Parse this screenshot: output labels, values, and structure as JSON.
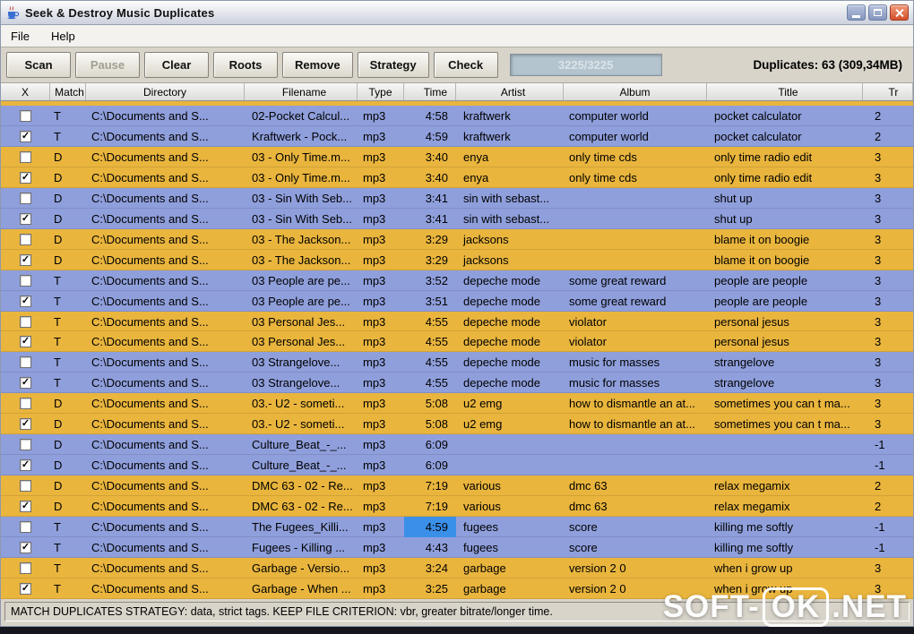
{
  "window": {
    "title": "Seek & Destroy Music Duplicates"
  },
  "menu": {
    "items": [
      "File",
      "Help"
    ]
  },
  "toolbar": {
    "buttons": [
      {
        "label": "Scan",
        "enabled": true
      },
      {
        "label": "Pause",
        "enabled": false
      },
      {
        "label": "Clear",
        "enabled": true
      },
      {
        "label": "Roots",
        "enabled": true
      },
      {
        "label": "Remove",
        "enabled": true
      },
      {
        "label": "Strategy",
        "enabled": true
      },
      {
        "label": "Check",
        "enabled": true
      }
    ],
    "progress_text": "3225/3225",
    "duplicates_label": "Duplicates: 63 (309,34MB)"
  },
  "table": {
    "columns": [
      "X",
      "Match",
      "Directory",
      "Filename",
      "Type",
      "Time",
      "Artist",
      "Album",
      "Title",
      "Tr"
    ],
    "check_glyph": "✓",
    "rows": [
      {
        "group": "blue",
        "checked": false,
        "match": "T",
        "dir": "C:\\Documents and S...",
        "file": "02-Pocket Calcul...",
        "type": "mp3",
        "time": "4:58",
        "artist": "kraftwerk",
        "album": "computer world",
        "title": "pocket calculator",
        "tr": "2"
      },
      {
        "group": "blue",
        "checked": true,
        "match": "T",
        "dir": "C:\\Documents and S...",
        "file": "Kraftwerk - Pock...",
        "type": "mp3",
        "time": "4:59",
        "artist": "kraftwerk",
        "album": "computer world",
        "title": "pocket calculator",
        "tr": "2"
      },
      {
        "group": "yellow",
        "checked": false,
        "match": "D",
        "dir": "C:\\Documents and S...",
        "file": "03 - Only Time.m...",
        "type": "mp3",
        "time": "3:40",
        "artist": "enya",
        "album": "only time cds",
        "title": "only time radio edit",
        "tr": "3"
      },
      {
        "group": "yellow",
        "checked": true,
        "match": "D",
        "dir": "C:\\Documents and S...",
        "file": "03 - Only Time.m...",
        "type": "mp3",
        "time": "3:40",
        "artist": "enya",
        "album": "only time cds",
        "title": "only time radio edit",
        "tr": "3"
      },
      {
        "group": "blue",
        "checked": false,
        "match": "D",
        "dir": "C:\\Documents and S...",
        "file": "03 - Sin With Seb...",
        "type": "mp3",
        "time": "3:41",
        "artist": "sin with sebast...",
        "album": "",
        "title": "shut up",
        "tr": "3"
      },
      {
        "group": "blue",
        "checked": true,
        "match": "D",
        "dir": "C:\\Documents and S...",
        "file": "03 - Sin With Seb...",
        "type": "mp3",
        "time": "3:41",
        "artist": "sin with sebast...",
        "album": "",
        "title": "shut up",
        "tr": "3"
      },
      {
        "group": "yellow",
        "checked": false,
        "match": "D",
        "dir": "C:\\Documents and S...",
        "file": "03 - The Jackson...",
        "type": "mp3",
        "time": "3:29",
        "artist": "jacksons",
        "album": "",
        "title": "blame it on boogie",
        "tr": "3"
      },
      {
        "group": "yellow",
        "checked": true,
        "match": "D",
        "dir": "C:\\Documents and S...",
        "file": "03 - The Jackson...",
        "type": "mp3",
        "time": "3:29",
        "artist": "jacksons",
        "album": "",
        "title": "blame it on boogie",
        "tr": "3"
      },
      {
        "group": "blue",
        "checked": false,
        "match": "T",
        "dir": "C:\\Documents and S...",
        "file": "03 People are pe...",
        "type": "mp3",
        "time": "3:52",
        "artist": "depeche mode",
        "album": "some great reward",
        "title": "people are people",
        "tr": "3"
      },
      {
        "group": "blue",
        "checked": true,
        "match": "T",
        "dir": "C:\\Documents and S...",
        "file": "03 People are pe...",
        "type": "mp3",
        "time": "3:51",
        "artist": "depeche mode",
        "album": "some great reward",
        "title": "people are people",
        "tr": "3"
      },
      {
        "group": "yellow",
        "checked": false,
        "match": "T",
        "dir": "C:\\Documents and S...",
        "file": "03 Personal Jes...",
        "type": "mp3",
        "time": "4:55",
        "artist": "depeche mode",
        "album": "violator",
        "title": "personal jesus",
        "tr": "3"
      },
      {
        "group": "yellow",
        "checked": true,
        "match": "T",
        "dir": "C:\\Documents and S...",
        "file": "03 Personal Jes...",
        "type": "mp3",
        "time": "4:55",
        "artist": "depeche mode",
        "album": "violator",
        "title": "personal jesus",
        "tr": "3"
      },
      {
        "group": "blue",
        "checked": false,
        "match": "T",
        "dir": "C:\\Documents and S...",
        "file": "03 Strangelove...",
        "type": "mp3",
        "time": "4:55",
        "artist": "depeche mode",
        "album": "music for masses",
        "title": "strangelove",
        "tr": "3"
      },
      {
        "group": "blue",
        "checked": true,
        "match": "T",
        "dir": "C:\\Documents and S...",
        "file": "03 Strangelove...",
        "type": "mp3",
        "time": "4:55",
        "artist": "depeche mode",
        "album": "music for masses",
        "title": "strangelove",
        "tr": "3"
      },
      {
        "group": "yellow",
        "checked": false,
        "match": "D",
        "dir": "C:\\Documents and S...",
        "file": "03.- U2 - someti...",
        "type": "mp3",
        "time": "5:08",
        "artist": "u2 emg",
        "album": "how to dismantle an at...",
        "title": "sometimes you can t ma...",
        "tr": "3"
      },
      {
        "group": "yellow",
        "checked": true,
        "match": "D",
        "dir": "C:\\Documents and S...",
        "file": "03.- U2 - someti...",
        "type": "mp3",
        "time": "5:08",
        "artist": "u2 emg",
        "album": "how to dismantle an at...",
        "title": "sometimes you can t ma...",
        "tr": "3"
      },
      {
        "group": "blue",
        "checked": false,
        "match": "D",
        "dir": "C:\\Documents and S...",
        "file": "Culture_Beat_-_...",
        "type": "mp3",
        "time": "6:09",
        "artist": "",
        "album": "",
        "title": "",
        "tr": "-1"
      },
      {
        "group": "blue",
        "checked": true,
        "match": "D",
        "dir": "C:\\Documents and S...",
        "file": "Culture_Beat_-_...",
        "type": "mp3",
        "time": "6:09",
        "artist": "",
        "album": "",
        "title": "",
        "tr": "-1"
      },
      {
        "group": "yellow",
        "checked": false,
        "match": "D",
        "dir": "C:\\Documents and S...",
        "file": "DMC 63 - 02 - Re...",
        "type": "mp3",
        "time": "7:19",
        "artist": "various",
        "album": "dmc 63",
        "title": "relax megamix",
        "tr": "2"
      },
      {
        "group": "yellow",
        "checked": true,
        "match": "D",
        "dir": "C:\\Documents and S...",
        "file": "DMC 63 - 02 - Re...",
        "type": "mp3",
        "time": "7:19",
        "artist": "various",
        "album": "dmc 63",
        "title": "relax megamix",
        "tr": "2"
      },
      {
        "group": "blue",
        "checked": false,
        "match": "T",
        "dir": "C:\\Documents and S...",
        "file": "The Fugees_Killi...",
        "type": "mp3",
        "time": "4:59",
        "time_selected": true,
        "artist": "fugees",
        "album": "score",
        "title": "killing me softly",
        "tr": "-1"
      },
      {
        "group": "blue",
        "checked": true,
        "match": "T",
        "dir": "C:\\Documents and S...",
        "file": "Fugees - Killing ...",
        "type": "mp3",
        "time": "4:43",
        "artist": "fugees",
        "album": "score",
        "title": "killing me softly",
        "tr": "-1"
      },
      {
        "group": "yellow",
        "checked": false,
        "match": "T",
        "dir": "C:\\Documents and S...",
        "file": "Garbage - Versio...",
        "type": "mp3",
        "time": "3:24",
        "artist": "garbage",
        "album": "version 2 0",
        "title": "when i grow up",
        "tr": "3"
      },
      {
        "group": "yellow",
        "checked": true,
        "match": "T",
        "dir": "C:\\Documents and S...",
        "file": "Garbage - When ...",
        "type": "mp3",
        "time": "3:25",
        "artist": "garbage",
        "album": "version 2 0",
        "title": "when i grow up",
        "tr": "3"
      }
    ]
  },
  "status_bar": {
    "text": "MATCH DUPLICATES STRATEGY: data, strict tags. KEEP FILE CRITERION: vbr, greater bitrate/longer time."
  },
  "watermark": {
    "prefix": "SOFT-",
    "badge": "OK",
    "suffix": ".NET"
  },
  "colors": {
    "row_blue": "#8f9fdc",
    "row_yellow": "#e9b53d",
    "selected_cell": "#3a8fe8",
    "close_button": "#d44f2b"
  }
}
